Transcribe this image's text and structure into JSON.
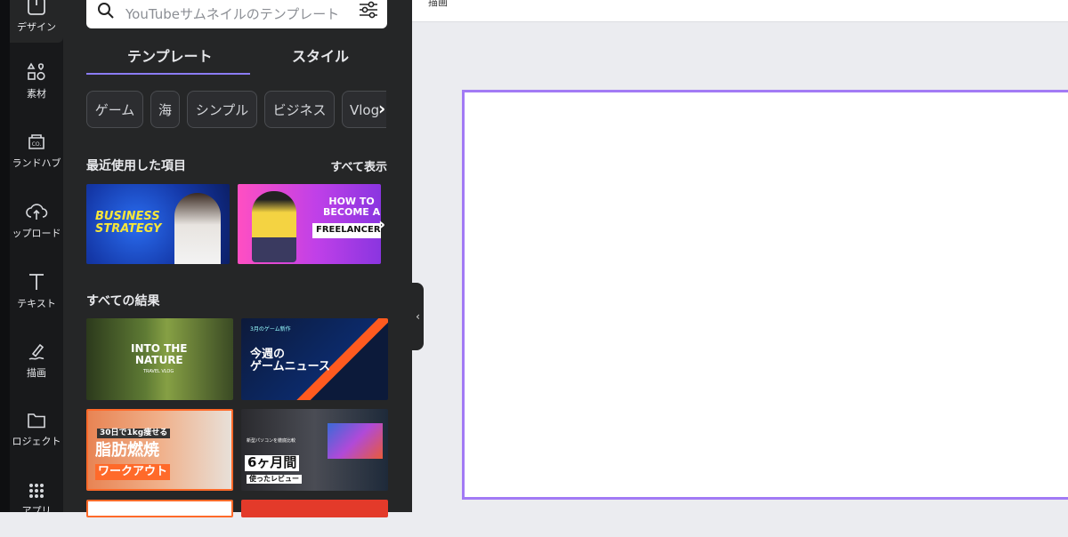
{
  "sidebar": {
    "items": [
      {
        "label": "デザイン",
        "icon": "layout-icon",
        "active": true
      },
      {
        "label": "素材",
        "icon": "shapes-icon"
      },
      {
        "label": "ランドハブ",
        "icon": "brand-icon"
      },
      {
        "label": "ップロード",
        "icon": "upload-icon"
      },
      {
        "label": "テキスト",
        "icon": "text-icon"
      },
      {
        "label": "描画",
        "icon": "draw-icon"
      },
      {
        "label": "ロジェクト",
        "icon": "folder-icon"
      },
      {
        "label": "アプリ",
        "icon": "apps-icon"
      }
    ]
  },
  "panel": {
    "search_placeholder": "YouTubeサムネイルのテンプレート",
    "tabs": [
      {
        "label": "テンプレート",
        "active": true
      },
      {
        "label": "スタイル"
      }
    ],
    "chips": [
      "ゲーム",
      "海",
      "シンプル",
      "ビジネス",
      "Vlog"
    ],
    "recent_title": "最近使用した項目",
    "see_all": "すべて表示",
    "recent": [
      {
        "text": "BUSINESS\nSTRATEGY"
      },
      {
        "text": "HOW TO\nBECOME A",
        "badge": "FREELANCER"
      }
    ],
    "results_title": "すべての結果",
    "results": [
      {
        "text": "INTO THE\nNATURE",
        "sub": "TRAVEL VLOG"
      },
      {
        "text": "今週の\nゲームニュース",
        "sub": "3月のゲーム新作"
      },
      {
        "text": "脂肪燃焼",
        "badge": "ワークアウト",
        "sub": "30日で1kg痩せる"
      },
      {
        "text": "6ヶ月間",
        "badge": "使ったレビュー",
        "sub": "新型パソコンを徹底比較"
      }
    ]
  },
  "colors": {
    "accent": "#8b7cf6",
    "canvas_border": "#a27af5",
    "panel_bg": "#252627"
  },
  "topbar": {
    "title_fragment": "描画"
  }
}
